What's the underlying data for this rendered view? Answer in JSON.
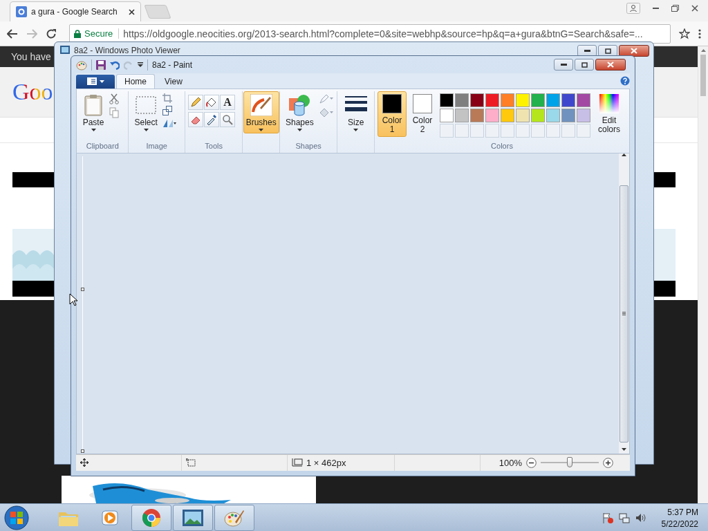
{
  "browser": {
    "tab": {
      "title": "a gura - Google Search"
    },
    "address_bar": {
      "security": "Secure",
      "url": "https://oldgoogle.neocities.org/2013-search.html?complete=0&site=webhp&source=hp&q=a+gura&btnG=Search&safe=..."
    }
  },
  "page": {
    "notice": "You have",
    "logo": "Goo"
  },
  "photo_viewer": {
    "title": "8a2 - Windows Photo Viewer"
  },
  "paint": {
    "title": "8a2 - Paint",
    "tabs": [
      {
        "label": "Home",
        "selected": true
      },
      {
        "label": "View",
        "selected": false
      }
    ],
    "ribbon": {
      "clipboard": {
        "label": "Clipboard",
        "paste": "Paste"
      },
      "image": {
        "label": "Image",
        "select": "Select"
      },
      "tools": {
        "label": "Tools",
        "text_glyph": "A"
      },
      "brushes": {
        "label": "Brushes",
        "selected": true
      },
      "shapes": {
        "label": "Shapes",
        "button": "Shapes"
      },
      "size": {
        "label": "Size"
      },
      "colors": {
        "label": "Colors",
        "edit": "Edit colors",
        "slots": [
          {
            "label": "Color 1",
            "selected": true,
            "color": "#000000"
          },
          {
            "label": "Color 2",
            "selected": false,
            "color": "#ffffff"
          }
        ],
        "palette": [
          {
            "color": "#000000"
          },
          {
            "color": "#7f7f7f"
          },
          {
            "color": "#880015"
          },
          {
            "color": "#ed1c24"
          },
          {
            "color": "#ff7f27"
          },
          {
            "color": "#fff200"
          },
          {
            "color": "#22b14c"
          },
          {
            "color": "#00a2e8"
          },
          {
            "color": "#3f48cc"
          },
          {
            "color": "#a349a4"
          },
          {
            "color": "#ffffff"
          },
          {
            "color": "#c3c3c3"
          },
          {
            "color": "#b97a57"
          },
          {
            "color": "#ffaec9"
          },
          {
            "color": "#ffc90e"
          },
          {
            "color": "#efe4b0"
          },
          {
            "color": "#b5e61d"
          },
          {
            "color": "#99d9ea"
          },
          {
            "color": "#7092be"
          },
          {
            "color": "#c8bfe7"
          }
        ]
      }
    },
    "status": {
      "image_size": "1 × 462px",
      "zoom": "100%",
      "zoom_slider": {
        "level": 0.5
      }
    }
  },
  "taskbar": {
    "apps": [
      {
        "kind": "explorer",
        "open": false
      },
      {
        "kind": "media",
        "open": false
      },
      {
        "kind": "chrome",
        "open": true
      },
      {
        "kind": "photos",
        "open": true
      },
      {
        "kind": "paint",
        "open": true
      }
    ],
    "clock": {
      "time": "5:37 PM",
      "date": "5/22/2022"
    }
  }
}
